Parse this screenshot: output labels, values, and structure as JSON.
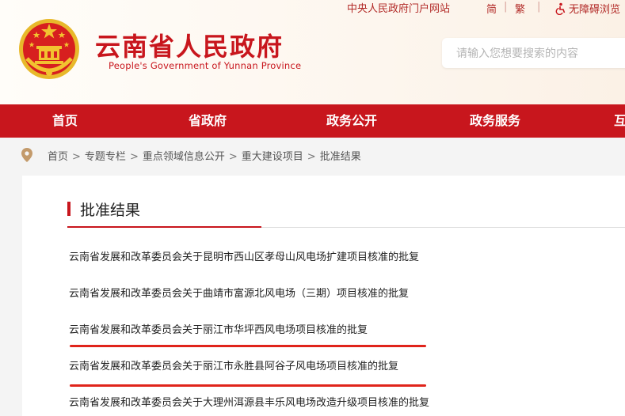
{
  "header": {
    "title": "云南省人民政府",
    "subtitle": "People's Government of Yunnan Province",
    "top_links": {
      "portal": "中央人民政府门户网站",
      "simplified": "简",
      "separator": "|",
      "traditional": "繁",
      "accessible": "无障碍浏览"
    },
    "search": {
      "placeholder": "请输入您想要搜索的内容"
    }
  },
  "nav": {
    "items": [
      "首页",
      "省政府",
      "政务公开",
      "政务服务",
      "互"
    ]
  },
  "breadcrumb": {
    "items": [
      "首页",
      "专题专栏",
      "重点领域信息公开",
      "重大建设项目",
      "批准结果"
    ],
    "separator": ">"
  },
  "section": {
    "title": "批准结果"
  },
  "list": {
    "items": [
      "云南省发展和改革委员会关于昆明市西山区孝母山风电场扩建项目核准的批复",
      "云南省发展和改革委员会关于曲靖市富源北风电场（三期）项目核准的批复",
      "云南省发展和改革委员会关于丽江市华坪西风电场项目核准的批复",
      "云南省发展和改革委员会关于丽江市永胜县阿谷子风电场项目核准的批复",
      "云南省发展和改革委员会关于大理州洱源县丰乐风电场改造升级项目核准的批复"
    ]
  },
  "colors": {
    "brand_red": "#c8161d",
    "highlight_red": "#e0241b",
    "gold": "#f2c230"
  },
  "icons": [
    "national-emblem-icon",
    "accessibility-icon",
    "location-pin-icon"
  ]
}
